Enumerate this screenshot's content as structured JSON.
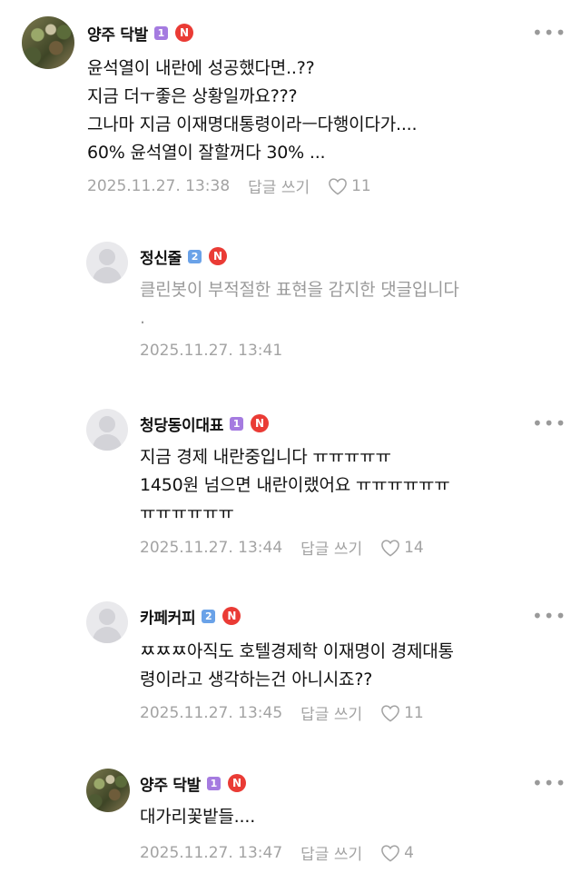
{
  "comments": [
    {
      "nickname": "양주 닥발",
      "level": "1",
      "badge": "N",
      "text": "윤석열이 내란에 성공했다면..??\n지금 더ㅜ좋은 상황일까요???\n그나마 지금 이재명대통령이라ㅡ다행이다가....\n60%  윤석열이 잘할꺼다 30% ...",
      "timestamp": "2025.11.27. 13:38",
      "reply_label": "답글 쓰기",
      "likes": "11"
    },
    {
      "nickname": "정신줄",
      "level": "2",
      "badge": "N",
      "text": "클린봇이 부적절한 표현을 감지한 댓글입니다\n.",
      "timestamp": "2025.11.27. 13:41"
    },
    {
      "nickname": "청당동이대표",
      "level": "1",
      "badge": "N",
      "text": "지금 경제 내란중입니다 ㅠㅠㅠㅠㅠ\n1450원 넘으면 내란이랬어요 ㅠㅠㅠㅠㅠㅠ\nㅠㅠㅠㅠㅠㅠ",
      "timestamp": "2025.11.27. 13:44",
      "reply_label": "답글 쓰기",
      "likes": "14"
    },
    {
      "nickname": "카페커피",
      "level": "2",
      "badge": "N",
      "text": "ㅉㅉㅉ아직도 호텔경제학 이재명이 경제대통\n령이라고 생각하는건 아니시죠??",
      "timestamp": "2025.11.27. 13:45",
      "reply_label": "답글 쓰기",
      "likes": "11"
    },
    {
      "nickname": "양주 닥발",
      "level": "1",
      "badge": "N",
      "text": "대가리꽃밭들....",
      "timestamp": "2025.11.27. 13:47",
      "reply_label": "답글 쓰기",
      "likes": "4"
    }
  ],
  "colors": {
    "level1": "#a57be0",
    "level2": "#6aa2e8",
    "new_badge": "#ea3b35",
    "meta_text": "#a3a3a3"
  },
  "icons": {
    "more": "more-horizontal-icon",
    "like": "heart-outline-icon"
  }
}
